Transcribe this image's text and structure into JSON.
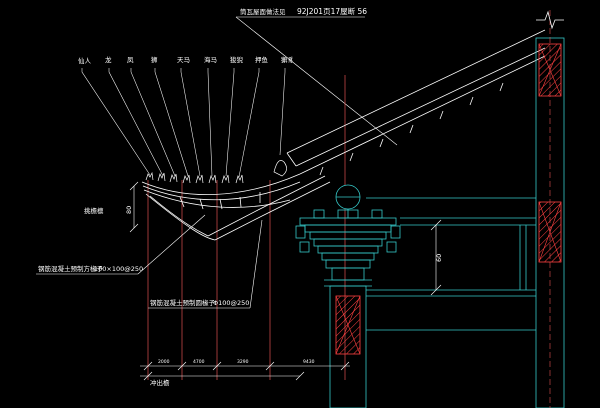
{
  "title_note": {
    "text": "筒瓦屋面做法见",
    "ref": "92J201页17屋断 56"
  },
  "ornaments": [
    "仙人",
    "龙",
    "凤",
    "狮",
    "天马",
    "海马",
    "狻猊",
    "押鱼",
    "獬豸"
  ],
  "eave_label": "挑檐檩",
  "eave_dim": "80",
  "note_square_rafter": {
    "text": "钢筋混凝土预制方椽子",
    "spec": "100×100@250"
  },
  "note_round_rafter": {
    "text": "钢筋混凝土预制圆椽子",
    "spec": "Φ100@250"
  },
  "dimensions": {
    "d1": "2000",
    "d2": "4700",
    "d3": "3290",
    "d4": "9430",
    "right": "60"
  },
  "bottom_label": "冲出檐",
  "colors": {
    "background": "#000000",
    "structure": "#35c8c8",
    "hatch": "#ff4040",
    "roof": "#ffffff",
    "dimension": "#e05050"
  }
}
